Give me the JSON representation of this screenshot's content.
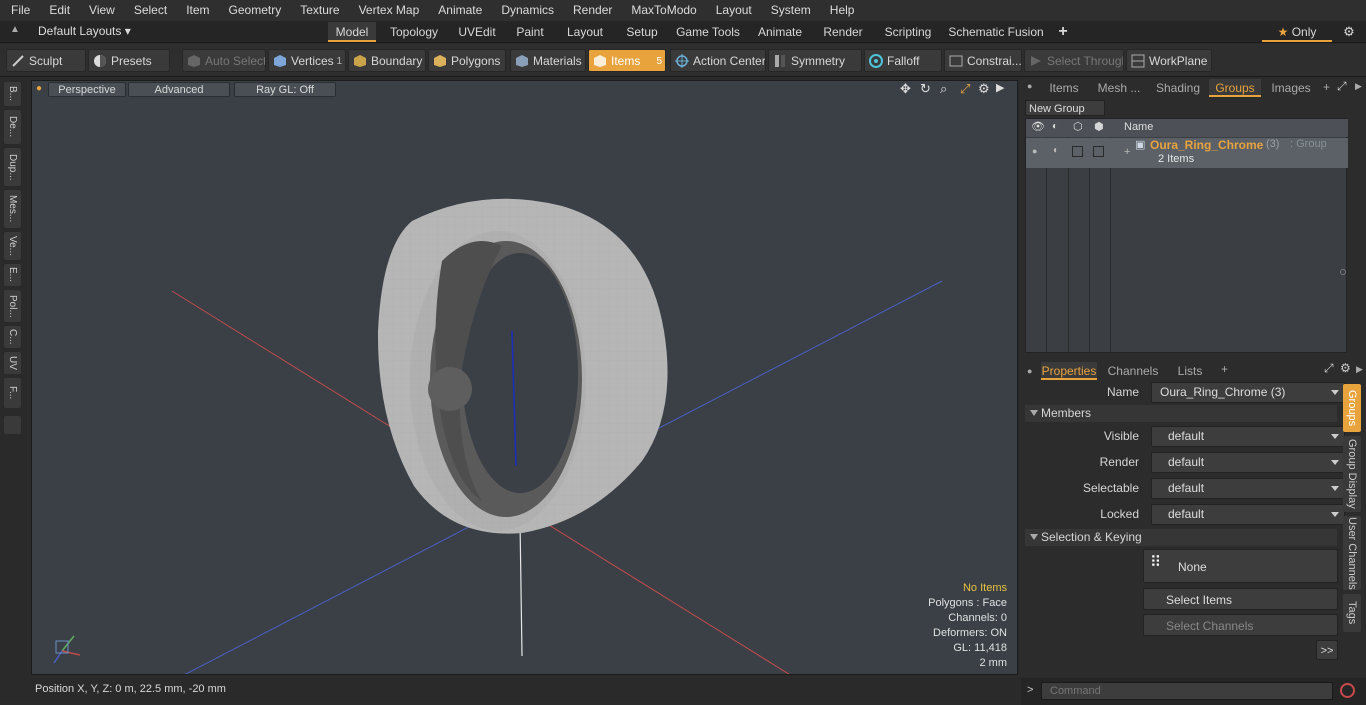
{
  "menu": [
    "File",
    "Edit",
    "View",
    "Select",
    "Item",
    "Geometry",
    "Texture",
    "Vertex Map",
    "Animate",
    "Dynamics",
    "Render",
    "MaxToModo",
    "Layout",
    "System",
    "Help"
  ],
  "layouts": {
    "label": "Default Layouts ▾",
    "tabs": [
      "Model",
      "Topology",
      "UVEdit",
      "Paint",
      "Layout",
      "Setup",
      "Game Tools",
      "Animate",
      "Render",
      "Scripting",
      "Schematic Fusion"
    ],
    "add": "+",
    "only": "Only"
  },
  "toolbar": {
    "sculpt": "Sculpt",
    "presets": "Presets",
    "auto_select": "Auto Select",
    "vertices": "Vertices",
    "vertices_count": "1",
    "boundary": "Boundary",
    "polygons": "Polygons",
    "materials": "Materials",
    "items": "Items",
    "items_count": "5",
    "action_center": "Action Center",
    "symmetry": "Symmetry",
    "falloff": "Falloff",
    "constraints": "Constrai...",
    "select_through": "Select Through",
    "workplane": "WorkPlane"
  },
  "left_tabs": [
    "B...",
    "De...",
    "Dup...",
    "Mes...",
    "Ve...",
    "E...",
    "Pol...",
    "C...",
    "UV",
    "F..."
  ],
  "viewport": {
    "view": "Perspective",
    "shading": "Advanced",
    "raygl": "Ray GL: Off",
    "info": {
      "items": "No Items",
      "polygons": "Polygons : Face",
      "channels": "Channels: 0",
      "deformers": "Deformers: ON",
      "gl": "GL: 11,418",
      "scale": "2 mm"
    }
  },
  "status": {
    "position": "Position X, Y, Z:   0 m, 22.5 mm, -20 mm"
  },
  "right": {
    "tabs": [
      "Items",
      "Mesh ...",
      "Shading",
      "Groups",
      "Images"
    ],
    "active_tab": "Groups",
    "new_group": "New Group",
    "col_name": "Name",
    "group": {
      "name": "Oura_Ring_Chrome",
      "count": "(3)",
      "type": ": Group",
      "items": "2 Items"
    },
    "prop_tabs": [
      "Properties",
      "Channels",
      "Lists"
    ],
    "name_label": "Name",
    "name_value": "Oura_Ring_Chrome (3)",
    "members": "Members",
    "fields": [
      {
        "label": "Visible",
        "value": "default"
      },
      {
        "label": "Render",
        "value": "default"
      },
      {
        "label": "Selectable",
        "value": "default"
      },
      {
        "label": "Locked",
        "value": "default"
      }
    ],
    "selection_keying": "Selection & Keying",
    "none": "None",
    "select_items": "Select Items",
    "select_channels": "Select Channels",
    "more": ">>",
    "side_tabs": [
      "Groups",
      "Group Display",
      "User Channels",
      "Tags"
    ],
    "command_placeholder": "Command"
  },
  "colors": {
    "accent": "#e8a33d",
    "viewport_bg": "#3b4047",
    "panel_bg": "#2c2c2c"
  }
}
